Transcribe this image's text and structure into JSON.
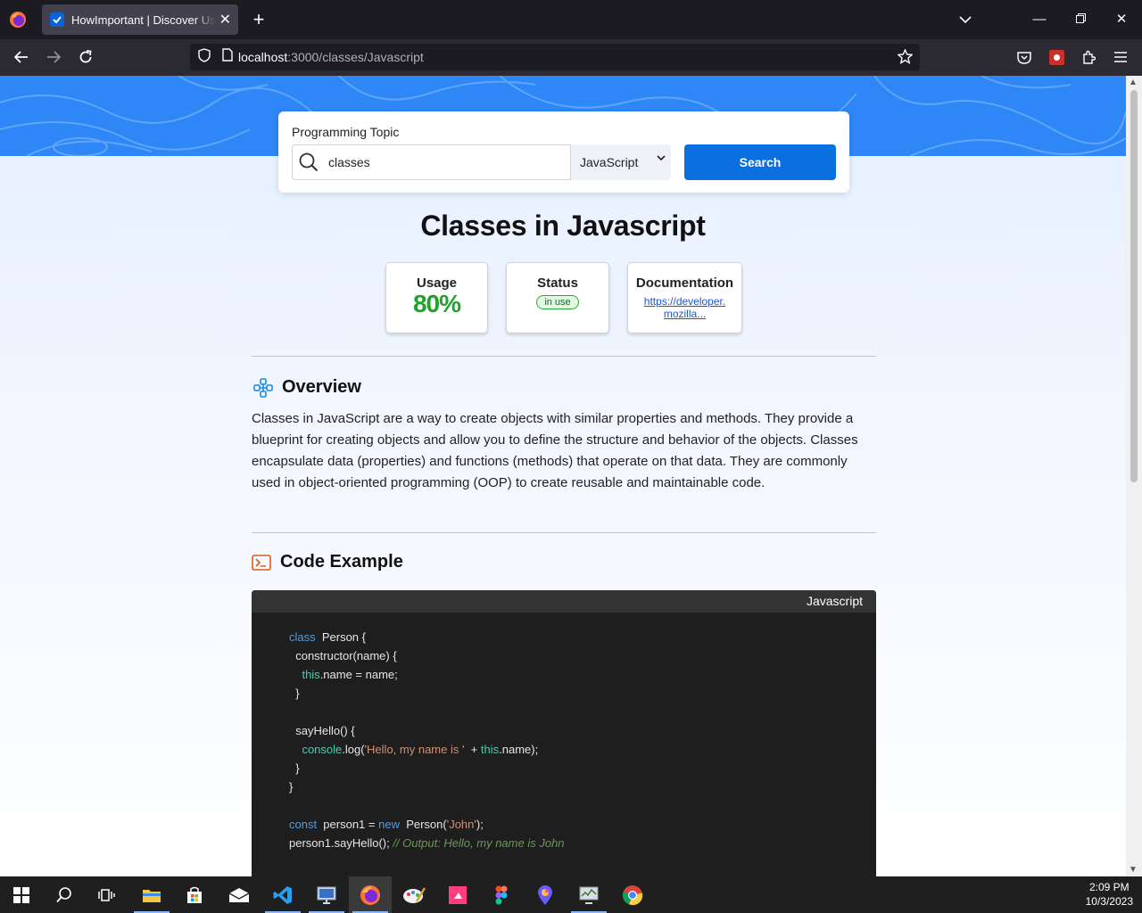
{
  "browser": {
    "tab_title": "HowImportant | Discover Useful",
    "url_host": "localhost",
    "url_path": ":3000/classes/Javascript"
  },
  "search": {
    "label": "Programming Topic",
    "query": "classes",
    "language": "JavaScript",
    "button": "Search"
  },
  "page": {
    "title": "Classes in Javascript"
  },
  "stats": {
    "usage_label": "Usage",
    "usage_value": "80%",
    "status_label": "Status",
    "status_value": "in use",
    "docs_label": "Documentation",
    "docs_link_line1": "https://developer.",
    "docs_link_line2": "mozilla..."
  },
  "overview": {
    "heading": "Overview",
    "text": "Classes in JavaScript are a way to create objects with similar properties and methods. They provide a blueprint for creating objects and allow you to define the structure and behavior of the objects. Classes encapsulate data (properties) and functions (methods) that operate on that data. They are commonly used in object-oriented programming (OOP) to create reusable and maintainable code."
  },
  "code_example": {
    "heading": "Code Example",
    "language": "Javascript",
    "lines": [
      [
        [
          "kw",
          "class"
        ],
        [
          "",
          "  Person {"
        ]
      ],
      [
        [
          "",
          "  constructor(name) {"
        ]
      ],
      [
        [
          "",
          "    "
        ],
        [
          "tk",
          "this"
        ],
        [
          "",
          ".name = name;"
        ]
      ],
      [
        [
          "",
          "  }"
        ]
      ],
      [
        [
          "",
          ""
        ]
      ],
      [
        [
          "",
          "  sayHello() {"
        ]
      ],
      [
        [
          "",
          "    "
        ],
        [
          "tk",
          "console"
        ],
        [
          "",
          ".log("
        ],
        [
          "st",
          "'Hello, my name is '"
        ],
        [
          "",
          "  + "
        ],
        [
          "tk",
          "this"
        ],
        [
          "",
          ".name);"
        ]
      ],
      [
        [
          "",
          "  }"
        ]
      ],
      [
        [
          "",
          "}"
        ]
      ],
      [
        [
          "",
          ""
        ]
      ],
      [
        [
          "kw",
          "const"
        ],
        [
          "",
          "  person1 = "
        ],
        [
          "kw",
          "new"
        ],
        [
          "",
          "  Person("
        ],
        [
          "st",
          "'John'"
        ],
        [
          "",
          ");"
        ]
      ],
      [
        [
          "",
          "person1.sayHello(); "
        ],
        [
          "cm",
          "// Output: Hello, my name is John"
        ]
      ]
    ]
  },
  "taskbar": {
    "time": "2:09 PM",
    "date": "10/3/2023"
  },
  "colors": {
    "accent": "#0b6fdf",
    "usage_green": "#1fa32d",
    "hero_blue": "#2f86f6",
    "code_bg": "#1e1e1e"
  }
}
